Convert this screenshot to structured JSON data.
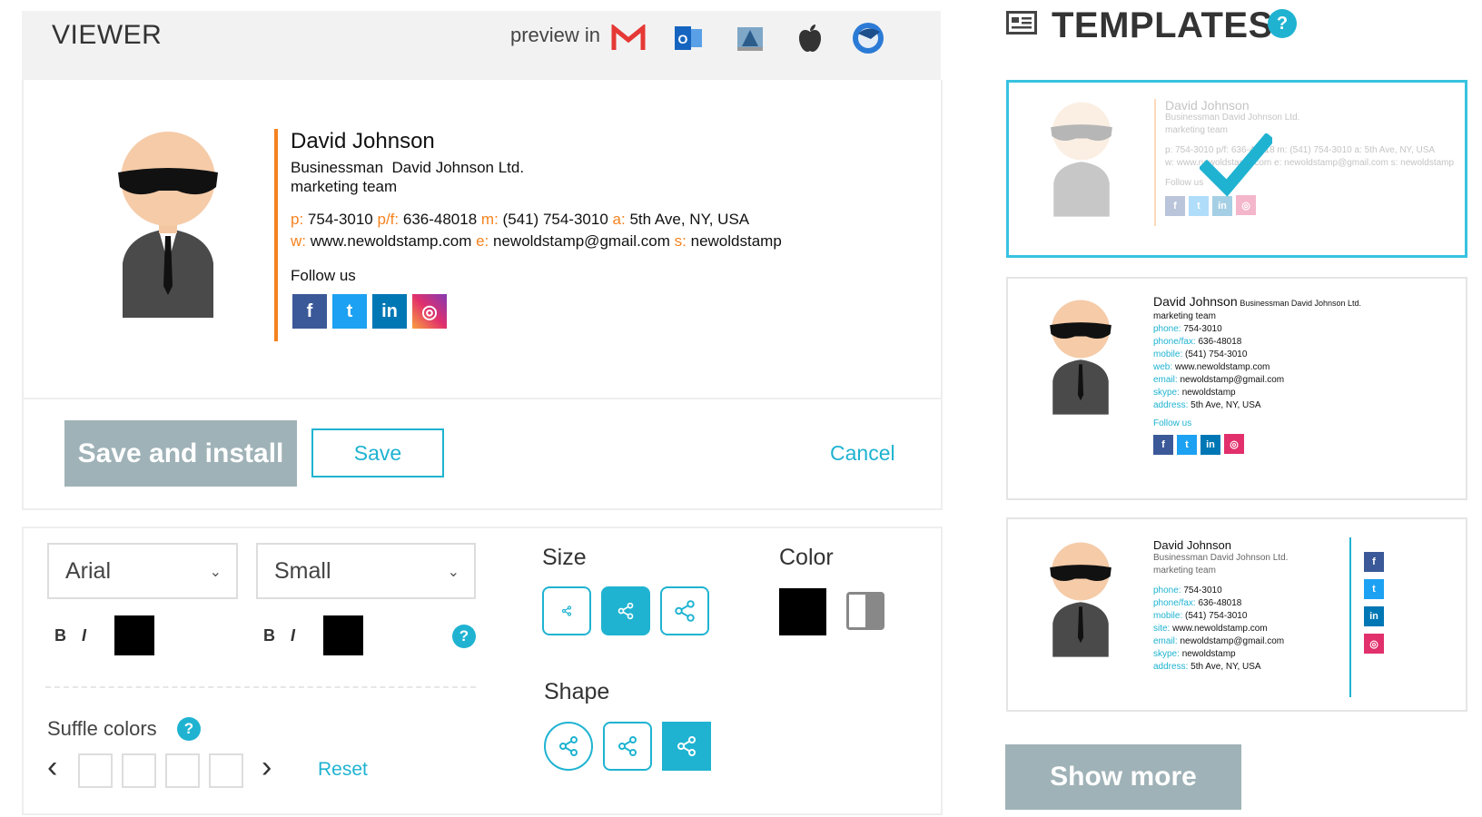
{
  "viewer": {
    "title": "VIEWER",
    "preview_label": "preview in",
    "clients": [
      "gmail-icon",
      "outlook-icon",
      "apple-mail-icon",
      "apple-icon",
      "thunderbird-icon"
    ]
  },
  "signature": {
    "name": "David Johnson",
    "title": "Businessman",
    "company": "David Johnson Ltd.",
    "team": "marketing team",
    "phone_label": "p:",
    "phone": "754-3010",
    "phonefax_label": "p/f:",
    "phonefax": "636-48018",
    "mobile_label": "m:",
    "mobile": "(541) 754-3010",
    "address_label": "a:",
    "address": "5th Ave, NY, USA",
    "web_label": "w:",
    "web": "www.newoldstamp.com",
    "email_label": "e:",
    "email": "newoldstamp@gmail.com",
    "skype_label": "s:",
    "skype": "newoldstamp",
    "follow_label": "Follow us",
    "social": [
      {
        "name": "facebook-icon",
        "glyph": "f",
        "color": "#3b5998"
      },
      {
        "name": "twitter-icon",
        "glyph": "t",
        "color": "#1da1f2"
      },
      {
        "name": "linkedin-icon",
        "glyph": "in",
        "color": "#0077b5"
      },
      {
        "name": "instagram-icon",
        "glyph": "◎",
        "color": "#e1306c"
      }
    ],
    "accent_color": "#f5821f"
  },
  "actions": {
    "save_install": "Save and install",
    "save": "Save",
    "cancel": "Cancel"
  },
  "editor": {
    "font_select": "Arial",
    "size_select": "Small",
    "bold": "B",
    "italic": "I",
    "size_title": "Size",
    "color_title": "Color",
    "shape_title": "Shape",
    "shuffle_label": "Suffle colors",
    "prev": "‹",
    "next": "›",
    "reset": "Reset",
    "help": "?"
  },
  "templates": {
    "title": "TEMPLATES",
    "help": "?",
    "show_more": "Show more",
    "cards": [
      {
        "name": "David Johnson",
        "line1": "Businessman  David Johnson Ltd.",
        "line2": "marketing team",
        "line3": "p: 754-3010  p/f: 636-48018  m: (541) 754-3010  a: 5th Ave, NY, USA",
        "line4": "w: www.newoldstamp.com  e: newoldstamp@gmail.com  s: newoldstamp",
        "follow": "Follow us"
      },
      {
        "name": "David Johnson",
        "title": "Businessman  David Johnson Ltd.",
        "team": "marketing team",
        "rows": [
          {
            "label": "phone:",
            "value": "754-3010"
          },
          {
            "label": "phone/fax:",
            "value": "636-48018"
          },
          {
            "label": "mobile:",
            "value": "(541) 754-3010"
          },
          {
            "label": "web:",
            "value": "www.newoldstamp.com"
          },
          {
            "label": "email:",
            "value": "newoldstamp@gmail.com"
          },
          {
            "label": "skype:",
            "value": "newoldstamp"
          },
          {
            "label": "address:",
            "value": "5th Ave, NY, USA"
          }
        ],
        "follow": "Follow us"
      },
      {
        "name": "David Johnson",
        "title": "Businessman  David Johnson Ltd.",
        "team": "marketing team",
        "rows": [
          {
            "label": "phone:",
            "value": "754-3010"
          },
          {
            "label": "phone/fax:",
            "value": "636-48018"
          },
          {
            "label": "mobile:",
            "value": "(541) 754-3010"
          },
          {
            "label": "site:",
            "value": "www.newoldstamp.com"
          },
          {
            "label": "email:",
            "value": "newoldstamp@gmail.com"
          },
          {
            "label": "skype:",
            "value": "newoldstamp"
          },
          {
            "label": "address:",
            "value": "5th Ave, NY, USA"
          }
        ]
      }
    ]
  },
  "colors": {
    "accent": "#1fb3d1",
    "disabled_button": "#9fb2b7",
    "signature_accent": "#f5821f"
  }
}
